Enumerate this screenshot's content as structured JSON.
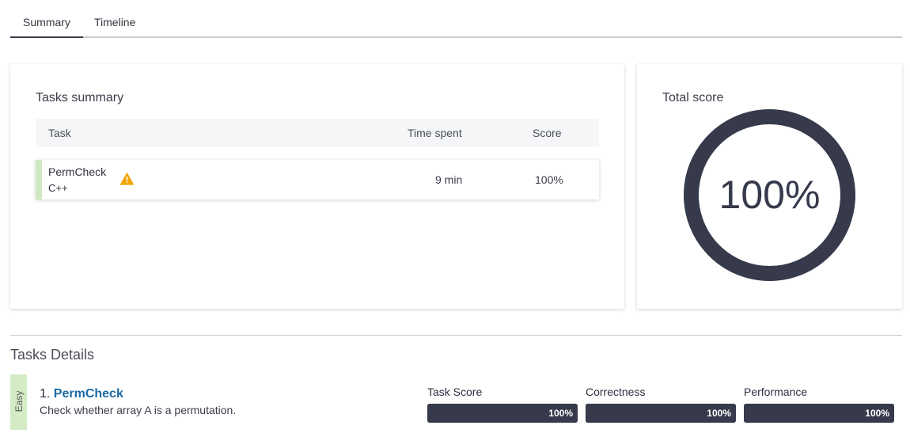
{
  "tabs": [
    {
      "label": "Summary",
      "active": true
    },
    {
      "label": "Timeline",
      "active": false
    }
  ],
  "tasks_summary": {
    "title": "Tasks summary",
    "columns": {
      "task": "Task",
      "time_spent": "Time spent",
      "score": "Score"
    },
    "rows": [
      {
        "name": "PermCheck",
        "language": "C++",
        "icon": "warning-icon",
        "time_spent": "9 min",
        "score": "100%"
      }
    ]
  },
  "total_score": {
    "title": "Total score",
    "value_text": "100%",
    "fraction": 1.0,
    "ring_color": "#363a4b"
  },
  "tasks_details": {
    "title": "Tasks Details",
    "items": [
      {
        "difficulty": "Easy",
        "number": "1.",
        "name": "PermCheck",
        "description": "Check whether array A is a permutation.",
        "metrics": [
          {
            "label": "Task Score",
            "value_text": "100%",
            "fraction": 1.0
          },
          {
            "label": "Correctness",
            "value_text": "100%",
            "fraction": 1.0
          },
          {
            "label": "Performance",
            "value_text": "100%",
            "fraction": 1.0
          }
        ]
      }
    ]
  },
  "colors": {
    "accent_dark": "#363a4b",
    "easy_green": "#d3ecc6",
    "row_stripe_green": "#cfe9c2",
    "link_blue": "#1b6aa5",
    "warning_amber": "#f0a500"
  }
}
